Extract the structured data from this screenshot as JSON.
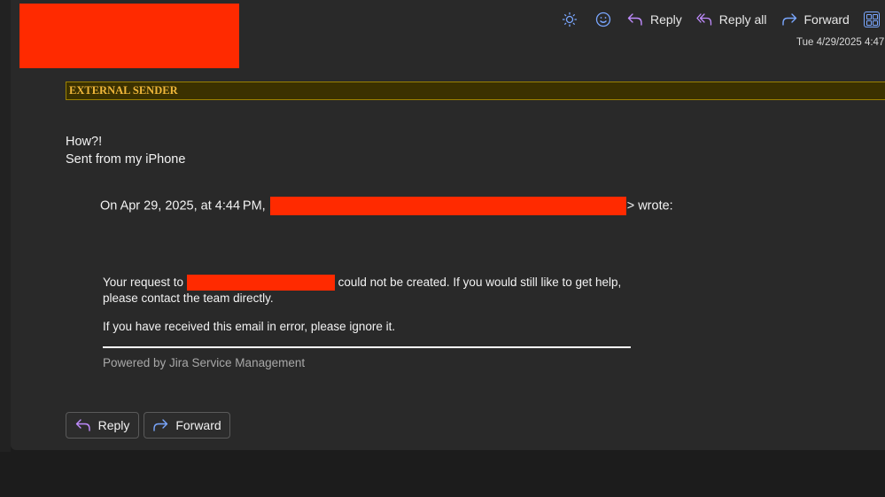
{
  "toolbar": {
    "icons": [
      "brightness-icon",
      "emoji-icon"
    ],
    "reply_label": "Reply",
    "reply_all_label": "Reply all",
    "forward_label": "Forward"
  },
  "header": {
    "timestamp": "Tue 4/29/2025 4:47"
  },
  "banner": {
    "text": "EXTERNAL SENDER"
  },
  "message": {
    "line1": "How?!",
    "line2": "Sent from my iPhone",
    "quote_prefix": "On Apr 29, 2025, at 4:44 PM,",
    "quote_suffix": "> wrote:",
    "request_prefix": "Your request to",
    "request_suffix": " could not be created. If you would still like to get help, please contact the team directly.",
    "error_note": "If you have received this email in error, please ignore it.",
    "powered_by": "Powered by Jira Service Management"
  },
  "actions": {
    "reply_label": "Reply",
    "forward_label": "Forward"
  },
  "colors": {
    "redaction": "#ff2a00",
    "banner_bg": "#3b3100",
    "banner_text": "#f0b73a",
    "accent_blue": "#7aa7ff",
    "accent_purple": "#c08cff"
  }
}
